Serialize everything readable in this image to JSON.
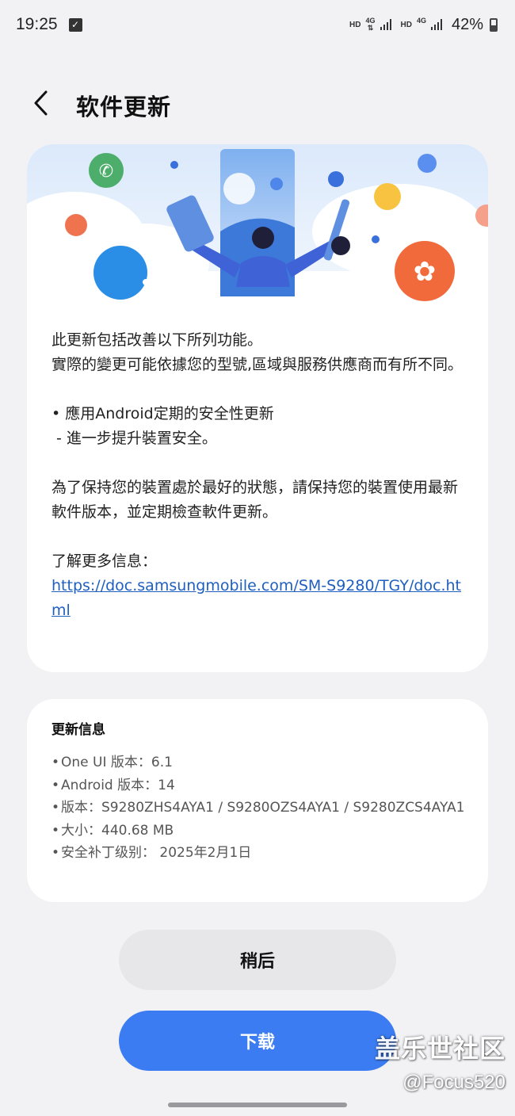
{
  "status_bar": {
    "time": "19:25",
    "net1": "HD",
    "net1_gen": "4G",
    "net2": "HD",
    "net2_gen": "4G",
    "battery_percent": "42%",
    "battery_level": 0.42
  },
  "header": {
    "title": "软件更新"
  },
  "release_notes": {
    "intro_line1": "此更新包括改善以下所列功能。",
    "intro_line2": "實際的變更可能依據您的型號,區域與服務供應商而有所不同。",
    "bullet": "• 應用Android定期的安全性更新",
    "sub_bullet": " - 進一步提升裝置安全。",
    "advice": "為了保持您的裝置處於最好的狀態，請保持您的裝置使用最新軟件版本，並定期檢查軟件更新。",
    "more_info_label": "了解更多信息：",
    "more_info_link": "https://doc.samsungmobile.com/SM-S9280/TGY/doc.html"
  },
  "update_info": {
    "title": "更新信息",
    "items": [
      "One UI 版本：6.1",
      "Android 版本：14",
      "版本：S9280ZHS4AYA1 / S9280OZS4AYA1 / S9280ZCS4AYA1",
      "大小：440.68 MB",
      "安全补丁级别： 2025年2月1日"
    ]
  },
  "buttons": {
    "later": "稍后",
    "download": "下载"
  },
  "watermark": {
    "line1": "盖乐世社区",
    "line2": "@Focus520"
  },
  "colors": {
    "accent": "#3b7cf2",
    "link": "#1f5fbf",
    "background": "#f2f2f4",
    "card": "#ffffff"
  }
}
